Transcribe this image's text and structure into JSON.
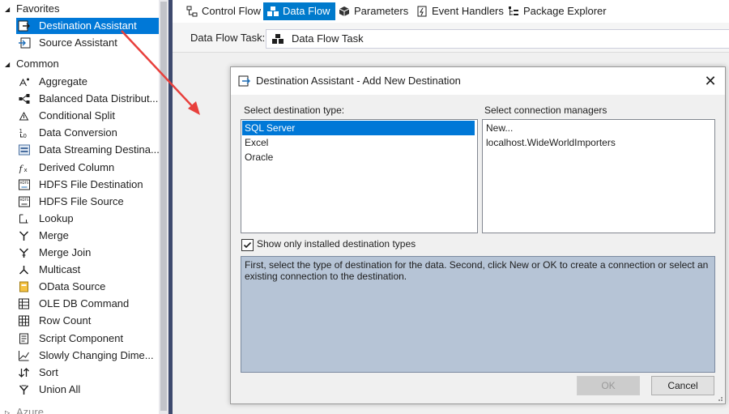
{
  "toolbox": {
    "favorites_header": "Favorites",
    "favorites": [
      {
        "label": "Destination Assistant",
        "icon": "destination-assistant-icon",
        "selected": true
      },
      {
        "label": "Source Assistant",
        "icon": "source-assistant-icon",
        "selected": false
      }
    ],
    "common_header": "Common",
    "common": [
      {
        "label": "Aggregate",
        "icon": "aggregate-icon"
      },
      {
        "label": "Balanced Data Distribut...",
        "icon": "balanced-data-distributor-icon"
      },
      {
        "label": "Conditional Split",
        "icon": "conditional-split-icon"
      },
      {
        "label": "Data Conversion",
        "icon": "data-conversion-icon"
      },
      {
        "label": "Data Streaming Destina...",
        "icon": "data-streaming-destination-icon"
      },
      {
        "label": "Derived Column",
        "icon": "derived-column-icon"
      },
      {
        "label": "HDFS File Destination",
        "icon": "hdfs-file-destination-icon"
      },
      {
        "label": "HDFS File Source",
        "icon": "hdfs-file-source-icon"
      },
      {
        "label": "Lookup",
        "icon": "lookup-icon"
      },
      {
        "label": "Merge",
        "icon": "merge-icon"
      },
      {
        "label": "Merge Join",
        "icon": "merge-join-icon"
      },
      {
        "label": "Multicast",
        "icon": "multicast-icon"
      },
      {
        "label": "OData Source",
        "icon": "odata-source-icon"
      },
      {
        "label": "OLE DB Command",
        "icon": "ole-db-command-icon"
      },
      {
        "label": "Row Count",
        "icon": "row-count-icon"
      },
      {
        "label": "Script Component",
        "icon": "script-component-icon"
      },
      {
        "label": "Slowly Changing Dime...",
        "icon": "slowly-changing-dimension-icon"
      },
      {
        "label": "Sort",
        "icon": "sort-icon"
      },
      {
        "label": "Union All",
        "icon": "union-all-icon"
      }
    ],
    "azure_header": "Azure"
  },
  "tabs": [
    {
      "label": "Control Flow",
      "icon": "control-flow-icon",
      "active": false
    },
    {
      "label": "Data Flow",
      "icon": "data-flow-icon",
      "active": true
    },
    {
      "label": "Parameters",
      "icon": "parameters-icon",
      "active": false
    },
    {
      "label": "Event Handlers",
      "icon": "event-handlers-icon",
      "active": false
    },
    {
      "label": "Package Explorer",
      "icon": "package-explorer-icon",
      "active": false
    }
  ],
  "data_flow_task": {
    "label": "Data Flow Task:",
    "value": "Data Flow Task"
  },
  "dialog": {
    "title": "Destination Assistant - Add New Destination",
    "close_glyph": "✕",
    "dest_type_label": "Select destination type:",
    "dest_types": [
      {
        "label": "SQL Server",
        "selected": true
      },
      {
        "label": "Excel",
        "selected": false
      },
      {
        "label": "Oracle",
        "selected": false
      }
    ],
    "conn_label": "Select connection managers",
    "connections": [
      {
        "label": "New..."
      },
      {
        "label": "localhost.WideWorldImporters"
      }
    ],
    "checkbox_label": "Show only installed destination types",
    "checkbox_checked": true,
    "description": "First, select the type of destination for the data. Second, click New or OK to create a connection or select an existing connection to the destination.",
    "ok_label": "OK",
    "ok_enabled": false,
    "cancel_label": "Cancel"
  },
  "colors": {
    "selection": "#0078d7",
    "active_tab": "#007acc",
    "arrow": "#e8403c",
    "description_bg": "#b6c4d6"
  }
}
